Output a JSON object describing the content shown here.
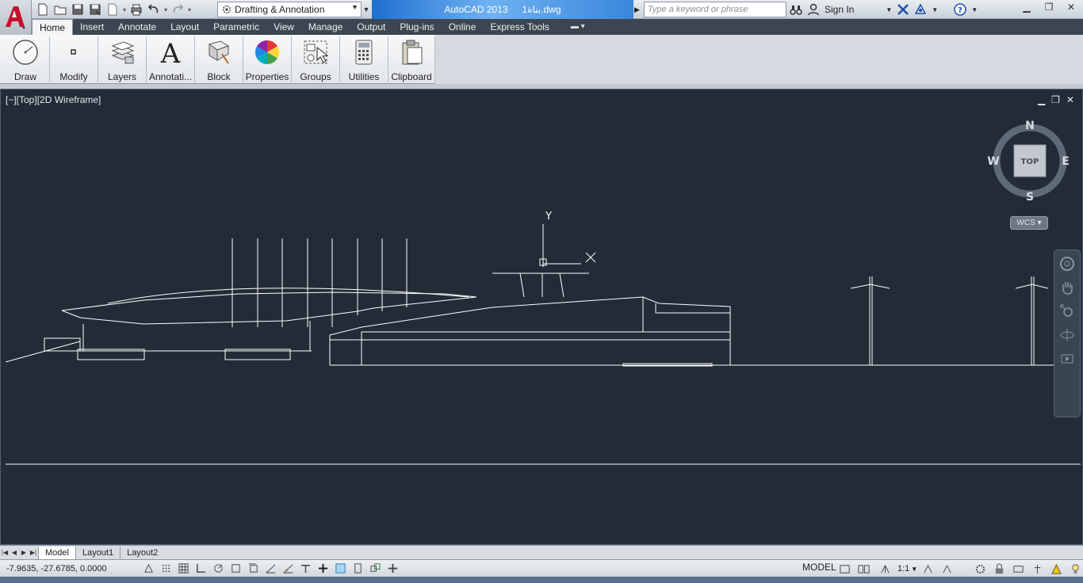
{
  "title_bar": {
    "app_title": "AutoCAD 2013",
    "file_name": "بناة1.dwg",
    "workspace": "Drafting & Annotation",
    "search_placeholder": "Type a keyword or phrase",
    "sign_in": "Sign In"
  },
  "ribbon": {
    "tabs": [
      "Home",
      "Insert",
      "Annotate",
      "Layout",
      "Parametric",
      "View",
      "Manage",
      "Output",
      "Plug-ins",
      "Online",
      "Express Tools"
    ],
    "active_tab": "Home",
    "panels": [
      "Draw",
      "Modify",
      "Layers",
      "Annotati...",
      "Block",
      "Properties",
      "Groups",
      "Utilities",
      "Clipboard"
    ]
  },
  "viewport": {
    "label": "[−][Top][2D Wireframe]",
    "viewcube": {
      "top": "TOP",
      "north": "N",
      "south": "S",
      "east": "E",
      "west": "W"
    },
    "wcs": "WCS",
    "ucs_y": "Y"
  },
  "layout_tabs": [
    "Model",
    "Layout1",
    "Layout2"
  ],
  "status_bar": {
    "coordinates": "-7.9635, -27.6785, 0.0000",
    "model": "MODEL",
    "annotation_scale": "1:1"
  },
  "colors": {
    "viewport_bg": "#222b36",
    "drawing_lines": "#ffffff",
    "title_accent": "#3a86db"
  }
}
